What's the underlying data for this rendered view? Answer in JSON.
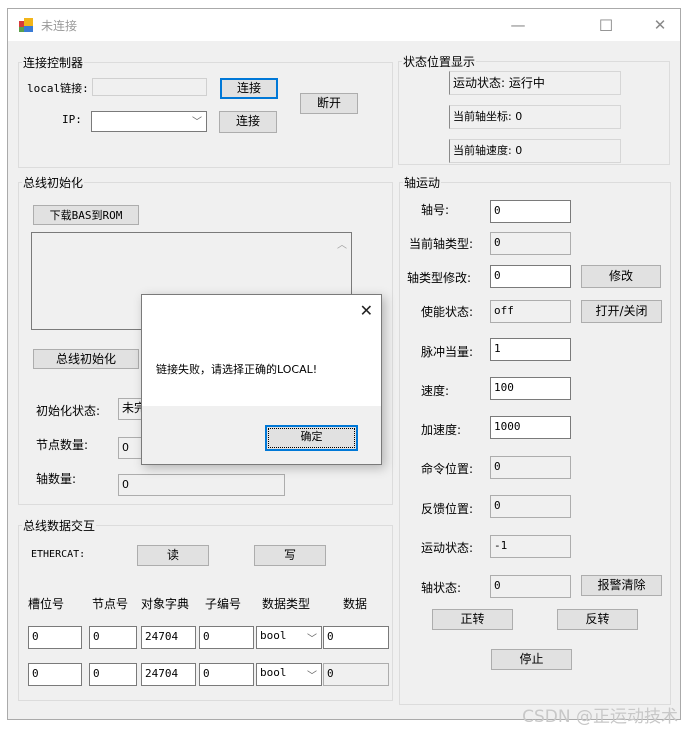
{
  "window": {
    "title": "未连接",
    "controls": {
      "minimize": "—",
      "maximize": "☐",
      "close": "✕"
    }
  },
  "connect_group": {
    "title": "连接控制器",
    "local_label": "local链接:",
    "local_value": "",
    "local_connect_button": "连接",
    "ip_label": "IP:",
    "ip_value": "",
    "ip_connect_button": "连接",
    "disconnect_button": "断开"
  },
  "status_group": {
    "title": "状态位置显示",
    "motion_status": "运动状态: 运行中",
    "current_axis_coord": "当前轴坐标: 0",
    "current_axis_speed": "当前轴速度: 0"
  },
  "bus_init_group": {
    "title": "总线初始化",
    "download_button": "下载BAS到ROM",
    "log_text": "",
    "init_button": "总线初始化",
    "init_status_label": "初始化状态:",
    "init_status_value": "未完成",
    "node_count_label": "节点数量:",
    "node_count_value": "0",
    "axis_count_label": "轴数量:",
    "axis_count_value": "0"
  },
  "bus_data_group": {
    "title": "总线数据交互",
    "ethercat_label": "ETHERCAT:",
    "read_button": "读",
    "write_button": "写",
    "columns": [
      "槽位号",
      "节点号",
      "对象字典",
      "子编号",
      "数据类型",
      "数据"
    ],
    "rows": [
      {
        "slot": "0",
        "node": "0",
        "object": "24704",
        "sub": "0",
        "type": "bool",
        "data": "0"
      },
      {
        "slot": "0",
        "node": "0",
        "object": "24704",
        "sub": "0",
        "type": "bool",
        "data": "0"
      }
    ]
  },
  "axis_group": {
    "title": "轴运动",
    "axis_no_label": "轴号:",
    "axis_no_value": "0",
    "current_type_label": "当前轴类型:",
    "current_type_value": "0",
    "type_modify_label": "轴类型修改:",
    "type_modify_value": "0",
    "modify_button": "修改",
    "enable_label": "使能状态:",
    "enable_value": "off",
    "toggle_button": "打开/关闭",
    "pulse_label": "脉冲当量:",
    "pulse_value": "1",
    "speed_label": "速度:",
    "speed_value": "100",
    "accel_label": "加速度:",
    "accel_value": "1000",
    "cmd_pos_label": "命令位置:",
    "cmd_pos_value": "0",
    "fb_pos_label": "反馈位置:",
    "fb_pos_value": "0",
    "motion_status_label": "运动状态:",
    "motion_status_value": "-1",
    "axis_status_label": "轴状态:",
    "axis_status_value": "0",
    "alarm_clear_button": "报警清除",
    "forward_button": "正转",
    "reverse_button": "反转",
    "stop_button": "停止"
  },
  "dialog": {
    "message": "链接失败，请选择正确的LOCAL!",
    "ok_button": "确定",
    "close": "✕"
  },
  "watermark": "CSDN @正运动技术"
}
